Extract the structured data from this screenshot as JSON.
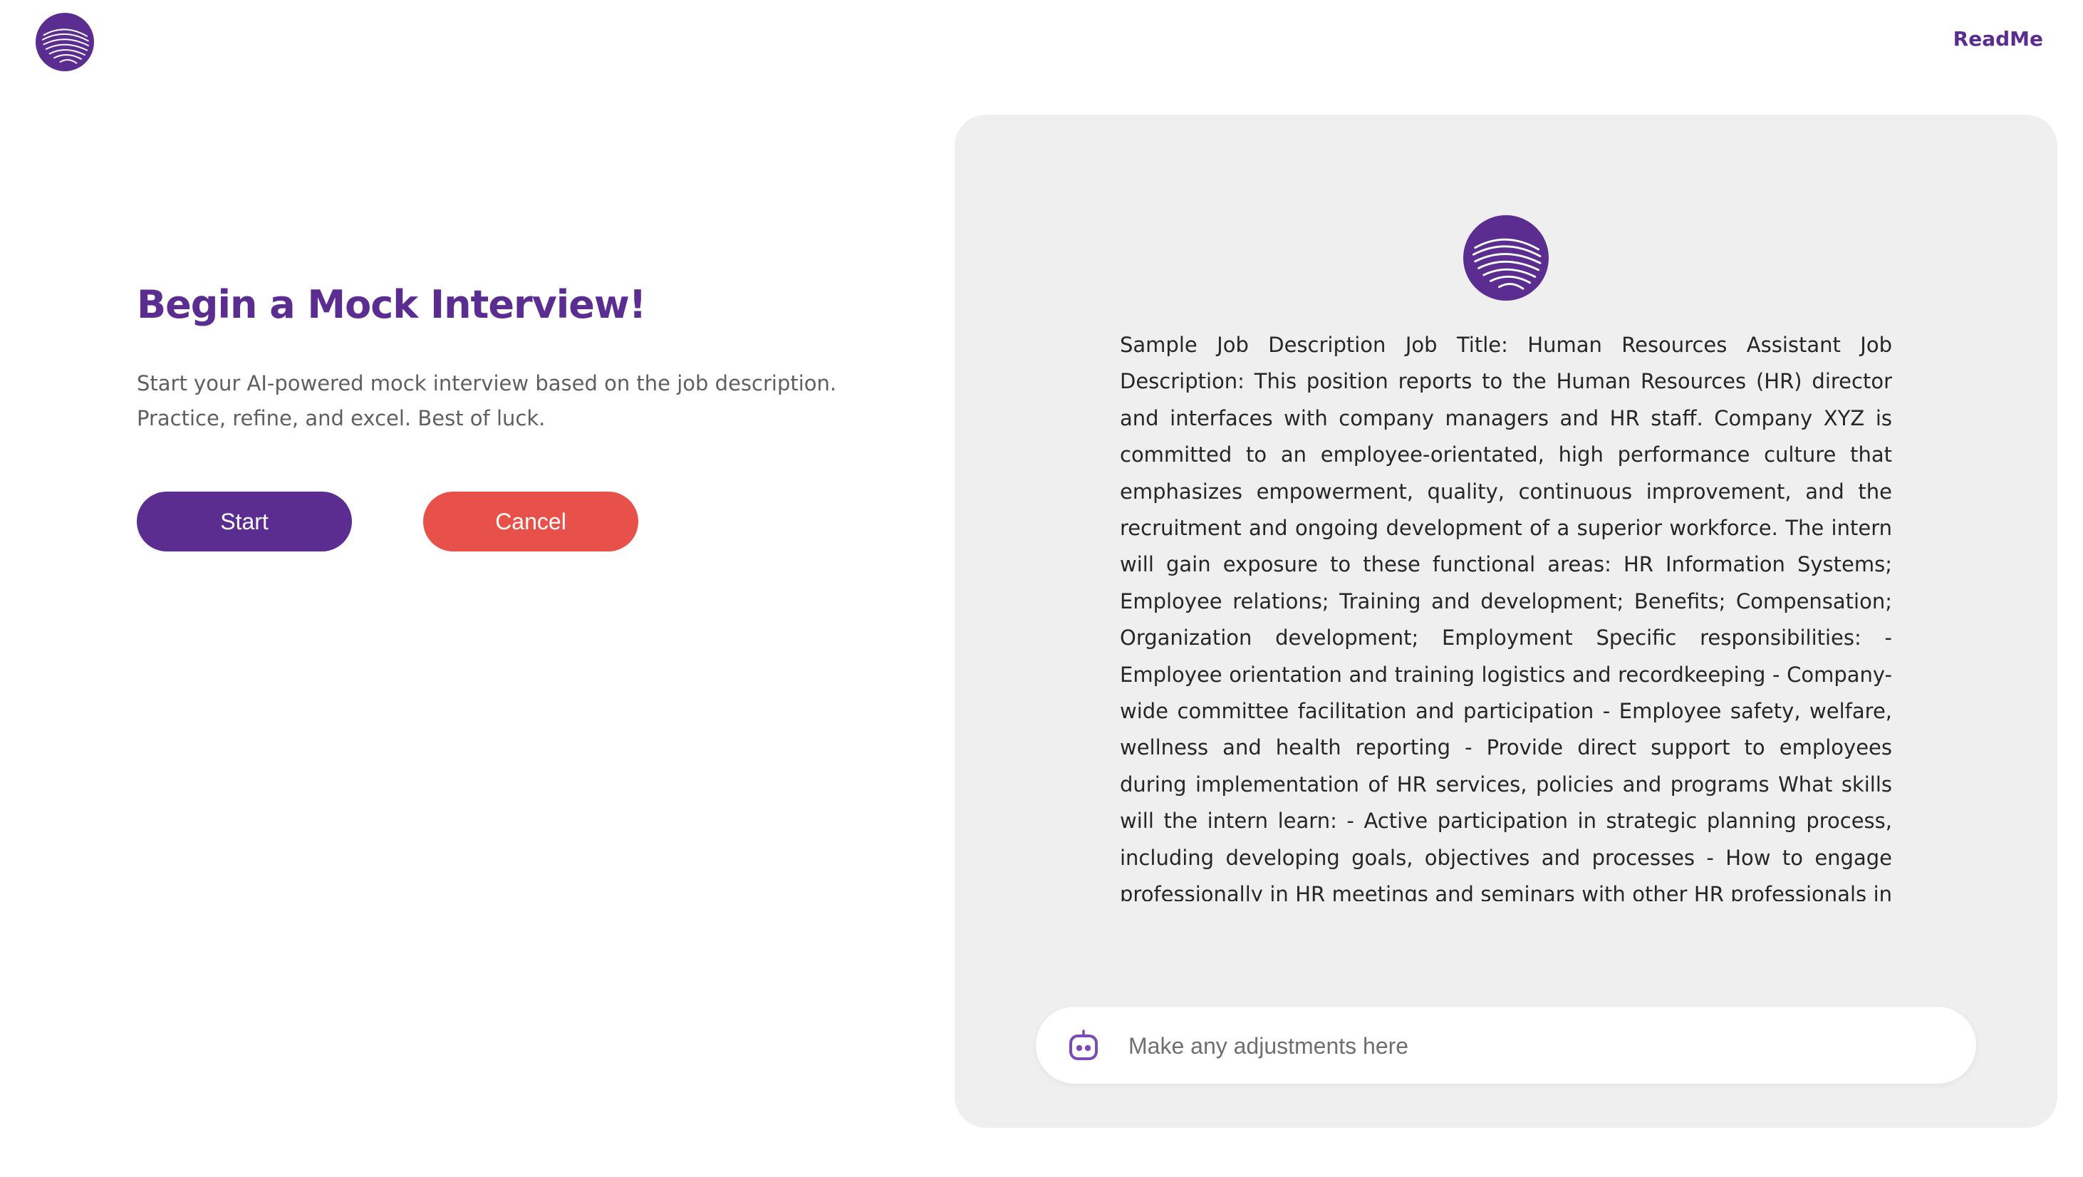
{
  "header": {
    "logo_icon": "fingerprint-logo-icon",
    "readme_label": "ReadMe"
  },
  "intro": {
    "title": "Begin a Mock Interview!",
    "subtitle": "Start your AI-powered mock interview based on the job description. Practice, refine, and excel. Best of luck.",
    "start_label": "Start",
    "cancel_label": "Cancel"
  },
  "panel": {
    "logo_icon": "fingerprint-logo-icon",
    "job_description": "Sample Job Description Job Title: Human Resources Assistant Job Description: This position reports to the Human Resources (HR) director and interfaces with company managers and HR staff. Company XYZ is committed to an employee-orientated, high performance culture that emphasizes empowerment, quality, continuous improvement, and the recruitment and ongoing development of a superior workforce. The intern will gain exposure to these functional areas: HR Information Systems; Employee relations; Training and development; Benefits; Compensation; Organization development; Employment Specific responsibilities: - Employee orientation and training logistics and recordkeeping - Company-wide committee facilitation and participation - Employee safety, welfare, wellness and health reporting - Provide direct support to employees during implementation of HR services, policies and programs What skills will the intern learn: - Active participation in strategic planning process, including developing goals, objectives and processes - How to engage professionally in HR meetings and seminars with other HR professionals in the region -",
    "input": {
      "icon": "robot-icon",
      "placeholder": "Make any adjustments here",
      "value": ""
    }
  },
  "colors": {
    "brand": "#5b2d91",
    "cancel": "#e8514a",
    "panel_bg": "#efefef"
  }
}
